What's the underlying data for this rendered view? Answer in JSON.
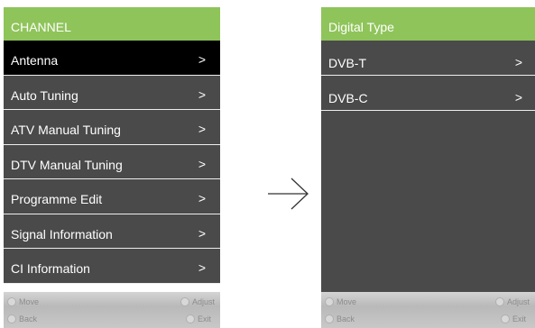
{
  "left_panel": {
    "header": "CHANNEL",
    "items": [
      {
        "label": "Antenna",
        "arrow": ">"
      },
      {
        "label": "Auto Tuning",
        "arrow": ">"
      },
      {
        "label": "ATV Manual Tuning",
        "arrow": ">"
      },
      {
        "label": "DTV Manual Tuning",
        "arrow": ">"
      },
      {
        "label": "Programme Edit",
        "arrow": ">"
      },
      {
        "label": "Signal Information",
        "arrow": ">"
      },
      {
        "label": "CI Information",
        "arrow": ">"
      }
    ],
    "footer": {
      "move": "Move",
      "adjust": "Adjust",
      "back": "Back",
      "exit": "Exit"
    }
  },
  "right_panel": {
    "header": "Digital Type",
    "items": [
      {
        "label": "DVB-T",
        "arrow": ">"
      },
      {
        "label": "DVB-C",
        "arrow": ">"
      }
    ],
    "footer": {
      "move": "Move",
      "adjust": "Adjust",
      "back": "Back",
      "exit": "Exit"
    }
  },
  "colors": {
    "header_green": "#8fc45a",
    "item_bg": "#4a4a4a",
    "selected_bg": "#000000"
  },
  "icons": {
    "transition": "right-arrow-icon",
    "hint": "remote-button-icon"
  }
}
